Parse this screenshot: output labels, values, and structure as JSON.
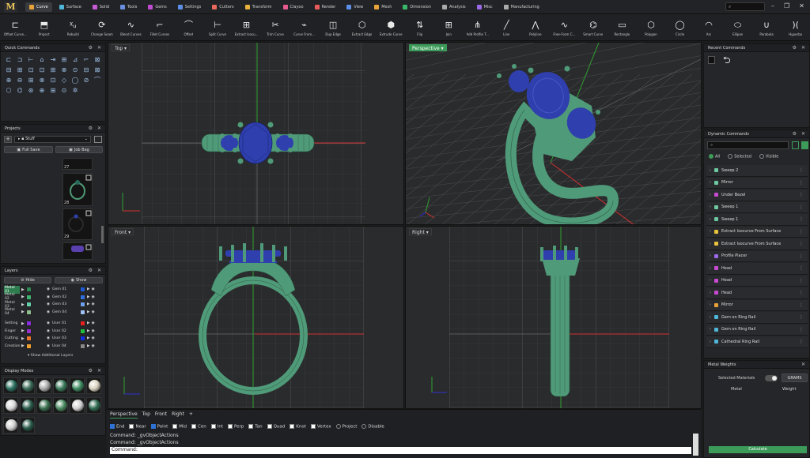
{
  "app": {
    "logo": "M"
  },
  "tabs": [
    {
      "label": "Curve",
      "color": "#e8a23a",
      "active": true
    },
    {
      "label": "Surface",
      "color": "#4fb6d8"
    },
    {
      "label": "Solid",
      "color": "#c75bd6"
    },
    {
      "label": "Tools",
      "color": "#6a8ee0"
    },
    {
      "label": "Gems",
      "color": "#c04ad0"
    },
    {
      "label": "Settings",
      "color": "#5b8fe8"
    },
    {
      "label": "Cutters",
      "color": "#e86a5b"
    },
    {
      "label": "Transform",
      "color": "#e8b23a"
    },
    {
      "label": "Clayoo",
      "color": "#e85b8f"
    },
    {
      "label": "Render",
      "color": "#e85b5b"
    },
    {
      "label": "View",
      "color": "#5b8fe8"
    },
    {
      "label": "Mesh",
      "color": "#e8a23a"
    },
    {
      "label": "Dimension",
      "color": "#3ab86a"
    },
    {
      "label": "Analysis",
      "color": "#aaaaaa"
    },
    {
      "label": "Misc",
      "color": "#9c6ae8"
    },
    {
      "label": "Manufacturing",
      "color": "#aaaaaa"
    }
  ],
  "search": {
    "placeholder": "⌕"
  },
  "toolbar": [
    {
      "label": "Offset Curve...",
      "icon": "⊏"
    },
    {
      "label": "Project",
      "icon": "⬒"
    },
    {
      "label": "Rebuild",
      "icon": "ᵡᵤ"
    },
    {
      "label": "Change Seam",
      "icon": "⟳"
    },
    {
      "label": "Blend Curves",
      "icon": "∿"
    },
    {
      "label": "Fillet Curves",
      "icon": "⌐"
    },
    {
      "label": "Offset",
      "icon": "⌒"
    },
    {
      "label": "Split Curve",
      "icon": "⊢"
    },
    {
      "label": "Extract Isocu...",
      "icon": "⊞"
    },
    {
      "label": "Trim Curve",
      "icon": "✂"
    },
    {
      "label": "Curve From...",
      "icon": "⌁"
    },
    {
      "label": "Dup Edge",
      "icon": "◫"
    },
    {
      "label": "Extract Edge",
      "icon": "⬡"
    },
    {
      "label": "Extrude Curve",
      "icon": "⬢"
    },
    {
      "label": "Flip",
      "icon": "⇅"
    },
    {
      "label": "Join",
      "icon": "⊞"
    },
    {
      "label": "Add Profile T...",
      "icon": "⋔"
    },
    {
      "label": "Line",
      "icon": "╱"
    },
    {
      "label": "Polyline",
      "icon": "⋀"
    },
    {
      "label": "Free-Form C...",
      "icon": "∿"
    },
    {
      "label": "Smart Curve",
      "icon": "⌬"
    },
    {
      "label": "Rectangle",
      "icon": "▭"
    },
    {
      "label": "Polygon",
      "icon": "⬡"
    },
    {
      "label": "Circle",
      "icon": "◯"
    },
    {
      "label": "Arc",
      "icon": "◠"
    },
    {
      "label": "Ellipse",
      "icon": "⬭"
    },
    {
      "label": "Parabola",
      "icon": "∪"
    },
    {
      "label": "Hyperbo",
      "icon": ")("
    }
  ],
  "quick_commands": {
    "title": "Quick Commands"
  },
  "projects": {
    "title": "Projects",
    "folder": "Stuff",
    "full_save": "Full Save",
    "job_bag": "Job Bag",
    "thumbs": [
      "27",
      "28",
      "29"
    ]
  },
  "layers": {
    "title": "Layers",
    "hide": "Hide",
    "show": "Show",
    "left": [
      {
        "name": "Metal 01",
        "color": "#2e8b57",
        "sel": true
      },
      {
        "name": "Metal 02",
        "color": "#3cb371"
      },
      {
        "name": "Metal 03",
        "color": "#66cdaa"
      },
      {
        "name": "Metal 04",
        "color": "#8fbc8f"
      },
      {
        "name": "Setting",
        "color": "#8a2be2"
      },
      {
        "name": "Finger",
        "color": "#9932cc"
      },
      {
        "name": "Cutting",
        "color": "#e8762d"
      },
      {
        "name": "Creation",
        "color": "#f0a030"
      }
    ],
    "right": [
      {
        "name": "Gem 01",
        "color": "#1e5bd6"
      },
      {
        "name": "Gem 02",
        "color": "#2f6fe0"
      },
      {
        "name": "Gem 03",
        "color": "#6ea0f0"
      },
      {
        "name": "Gem 04",
        "color": "#9ec0f5"
      },
      {
        "name": "User 01",
        "color": "#e82020"
      },
      {
        "name": "User 02",
        "color": "#20c040"
      },
      {
        "name": "User 03",
        "color": "#1030e0"
      },
      {
        "name": "User 04",
        "color": "#888888"
      }
    ],
    "more": "Show Additional Layers"
  },
  "display_modes": {
    "title": "Display Modes"
  },
  "viewports": {
    "top": "Top",
    "perspective": "Perspective",
    "front": "Front",
    "right": "Right"
  },
  "viewport_tabs": [
    "Perspective",
    "Top",
    "Front",
    "Right"
  ],
  "snaps": [
    {
      "label": "End",
      "on": true
    },
    {
      "label": "Near",
      "on": false
    },
    {
      "label": "Point",
      "on": true
    },
    {
      "label": "Mid",
      "on": false
    },
    {
      "label": "Cen",
      "on": false
    },
    {
      "label": "Int",
      "on": false
    },
    {
      "label": "Perp",
      "on": false
    },
    {
      "label": "Tan",
      "on": false
    },
    {
      "label": "Quad",
      "on": false
    },
    {
      "label": "Knot",
      "on": false
    },
    {
      "label": "Vertex",
      "on": false
    },
    {
      "label": "Project",
      "radio": true
    },
    {
      "label": "Disable",
      "radio": true
    }
  ],
  "command_history": [
    "Command: _gvObjectActions",
    "Command: _gvObjectActions"
  ],
  "command_prompt": "Command:",
  "recent_commands": {
    "title": "Recent Commands"
  },
  "dynamic_commands": {
    "title": "Dynamic Commands",
    "filters": [
      "All",
      "Selected",
      "Visible"
    ],
    "items": [
      {
        "label": "Sweep 2",
        "color": "#6ec8a0"
      },
      {
        "label": "Mirror",
        "color": "#6ec8a0"
      },
      {
        "label": "Under Bezel",
        "color": "#c84ad0"
      },
      {
        "label": "Sweep 1",
        "color": "#6ec8a0"
      },
      {
        "label": "Sweep 1",
        "color": "#6ec8a0"
      },
      {
        "label": "Extract Isocurve From Surface",
        "color": "#e8c23a"
      },
      {
        "label": "Extract Isocurve From Surface",
        "color": "#e8c23a"
      },
      {
        "label": "Profile Placer",
        "color": "#9c6ae8"
      },
      {
        "label": "Head",
        "color": "#c84ad0"
      },
      {
        "label": "Head",
        "color": "#c84ad0"
      },
      {
        "label": "Head",
        "color": "#c84ad0"
      },
      {
        "label": "Mirror",
        "color": "#e8a23a"
      },
      {
        "label": "Gem on Ring Rail",
        "color": "#4fb6d8"
      },
      {
        "label": "Gem on Ring Rail",
        "color": "#4fb6d8"
      },
      {
        "label": "Cathedral Ring Rail",
        "color": "#4fb6d8"
      }
    ]
  },
  "metal_weights": {
    "title": "Metal Weights",
    "selected": "Selected Materials",
    "grams": "GRAMS",
    "col1": "Metal",
    "col2": "Weight",
    "calc": "Calculate"
  },
  "colors": {
    "accent": "#3d9b5a",
    "metal": "#4f9a78",
    "gem": "#2f3fae"
  }
}
